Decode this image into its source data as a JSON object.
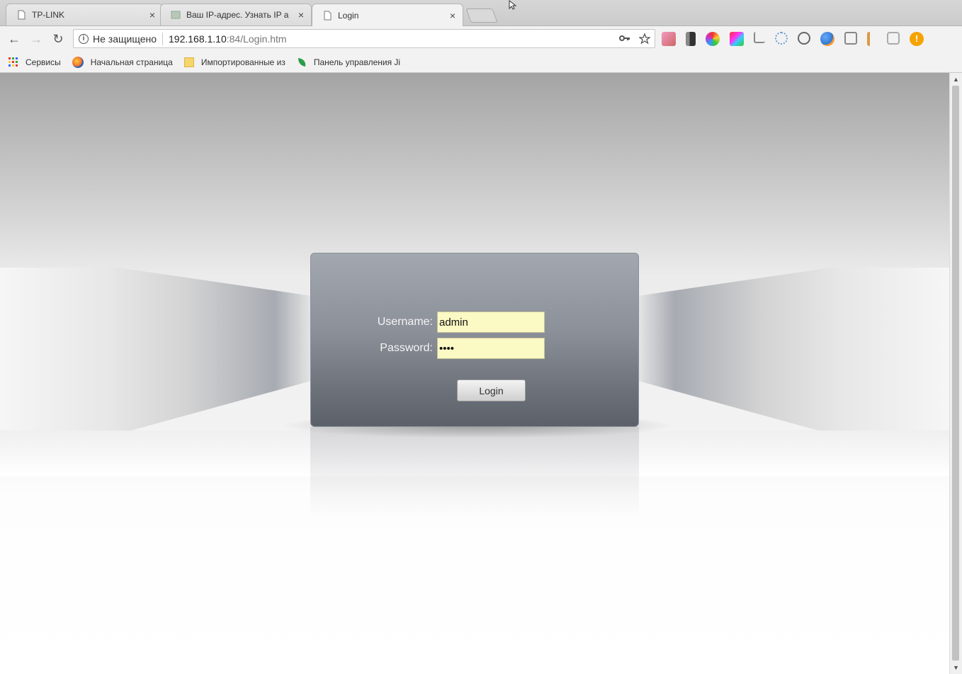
{
  "tabs": [
    {
      "title": "TP-LINK",
      "close": "×"
    },
    {
      "title": "Ваш IP-адрес. Узнать IP а",
      "close": "×"
    },
    {
      "title": "Login",
      "close": "×"
    }
  ],
  "toolbar": {
    "back": "←",
    "forward": "→",
    "reload": "↻",
    "security_text": "Не защищено",
    "url_host": "192.168.1.10",
    "url_path": ":84/Login.htm"
  },
  "bookmarks": [
    {
      "label": "Сервисы"
    },
    {
      "label": "Начальная страница"
    },
    {
      "label": "Импортированные из"
    },
    {
      "label": "Панель управления Ji"
    }
  ],
  "login": {
    "username_label": "Username:",
    "username_value": "admin",
    "password_label": "Password:",
    "password_value": "••••",
    "button_label": "Login"
  },
  "colors": {
    "input_bg": "#fbf9c4",
    "panel_top": "#a3a8b0",
    "panel_bottom": "#5b6069"
  }
}
